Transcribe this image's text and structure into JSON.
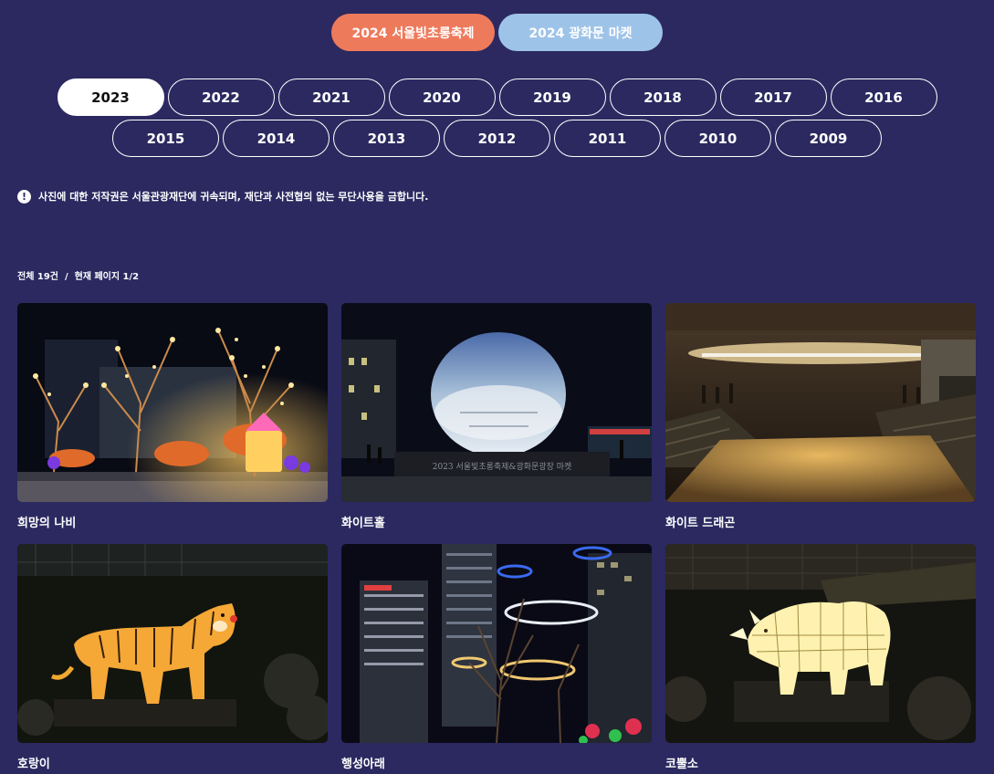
{
  "top_tabs": [
    "2024 서울빛초롱축제",
    "2024 광화문 마켓"
  ],
  "years_row1": [
    "2023",
    "2022",
    "2021",
    "2020",
    "2019",
    "2018",
    "2017",
    "2016"
  ],
  "years_row2": [
    "2015",
    "2014",
    "2013",
    "2012",
    "2011",
    "2010",
    "2009"
  ],
  "active_year": "2023",
  "notice": {
    "icon": "exclamation-icon",
    "text": "사진에 대한 저작권은 서울관광재단에 귀속되며, 재단과 사전협의 없는 무단사용을 금합니다."
  },
  "count_text": "전체 19건  /  현재 페이지 1/2",
  "gallery": [
    {
      "title": "희망의 나비",
      "image": "butterfly-lanterns-photo"
    },
    {
      "title": "화이트홀",
      "image": "whitehole-dome-photo",
      "sign_text": "2023 서울빛초롱축제&광화문광장 마켓"
    },
    {
      "title": "화이트 드래곤",
      "image": "stream-light-canopy-photo"
    },
    {
      "title": "호랑이",
      "image": "tiger-lantern-photo"
    },
    {
      "title": "행성아래",
      "image": "planet-rings-photo"
    },
    {
      "title": "코뿔소",
      "image": "rhino-lantern-photo"
    }
  ]
}
